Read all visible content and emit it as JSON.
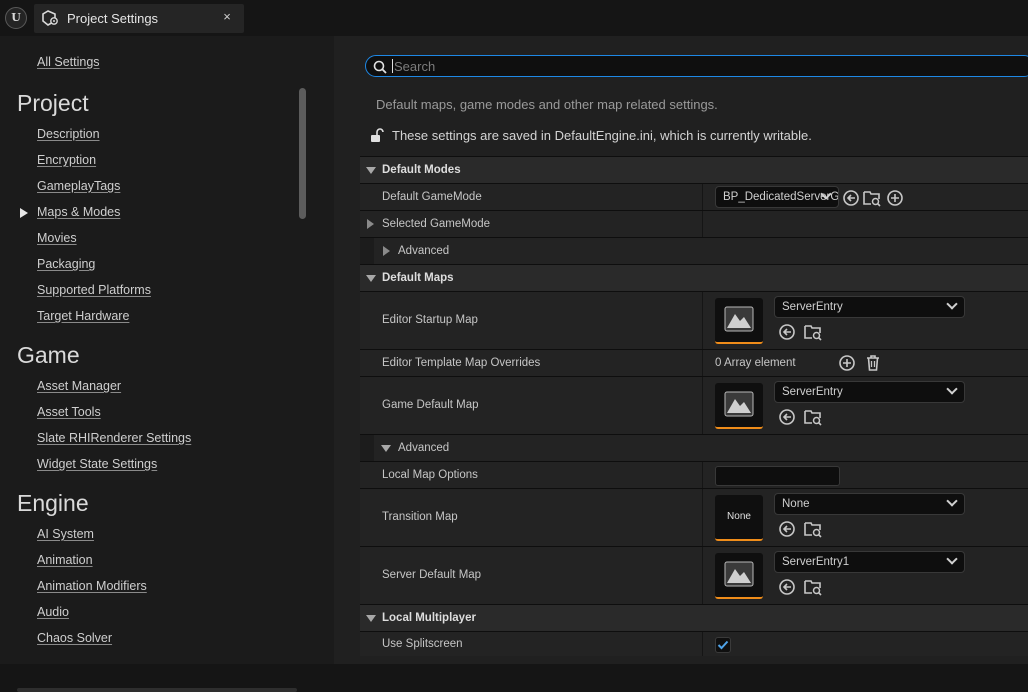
{
  "tab": {
    "title": "Project Settings",
    "close_glyph": "×",
    "icon": "project-settings-icon"
  },
  "app_logo": "U",
  "sidebar": {
    "all_settings": "All Settings",
    "sections": [
      {
        "heading": "Project",
        "items": [
          "Description",
          "Encryption",
          "GameplayTags",
          "Maps & Modes",
          "Movies",
          "Packaging",
          "Supported Platforms",
          "Target Hardware"
        ]
      },
      {
        "heading": "Game",
        "items": [
          "Asset Manager",
          "Asset Tools",
          "Slate RHIRenderer Settings",
          "Widget State Settings"
        ]
      },
      {
        "heading": "Engine",
        "items": [
          "AI System",
          "Animation",
          "Animation Modifiers",
          "Audio",
          "Chaos Solver"
        ]
      }
    ],
    "selected_item": "Maps & Modes"
  },
  "search": {
    "placeholder": "Search"
  },
  "section": {
    "description": "Default maps, game modes and other map related settings.",
    "writable_notice": "These settings are saved in DefaultEngine.ini, which is currently writable."
  },
  "props": {
    "default_modes": "Default Modes",
    "default_gamemode": {
      "label": "Default GameMode",
      "value": "BP_DedicatedServerGameMode"
    },
    "selected_gamemode": "Selected GameMode",
    "advanced": "Advanced",
    "default_maps": "Default Maps",
    "editor_startup_map": {
      "label": "Editor Startup Map",
      "value": "ServerEntry"
    },
    "editor_template_overrides": {
      "label": "Editor Template Map Overrides",
      "value": "0 Array element"
    },
    "game_default_map": {
      "label": "Game Default Map",
      "value": "ServerEntry"
    },
    "advanced2": "Advanced",
    "local_map_options": {
      "label": "Local Map Options",
      "value": ""
    },
    "transition_map": {
      "label": "Transition Map",
      "value": "None",
      "thumb_text": "None"
    },
    "server_default_map": {
      "label": "Server Default Map",
      "value": "ServerEntry1"
    },
    "local_multiplayer": "Local Multiplayer",
    "use_splitscreen": {
      "label": "Use Splitscreen",
      "checked": true
    }
  },
  "colors": {
    "accent": "#1e88e5",
    "thumb_underline": "#f08d1a",
    "checkbox": "#4fa3e8"
  }
}
